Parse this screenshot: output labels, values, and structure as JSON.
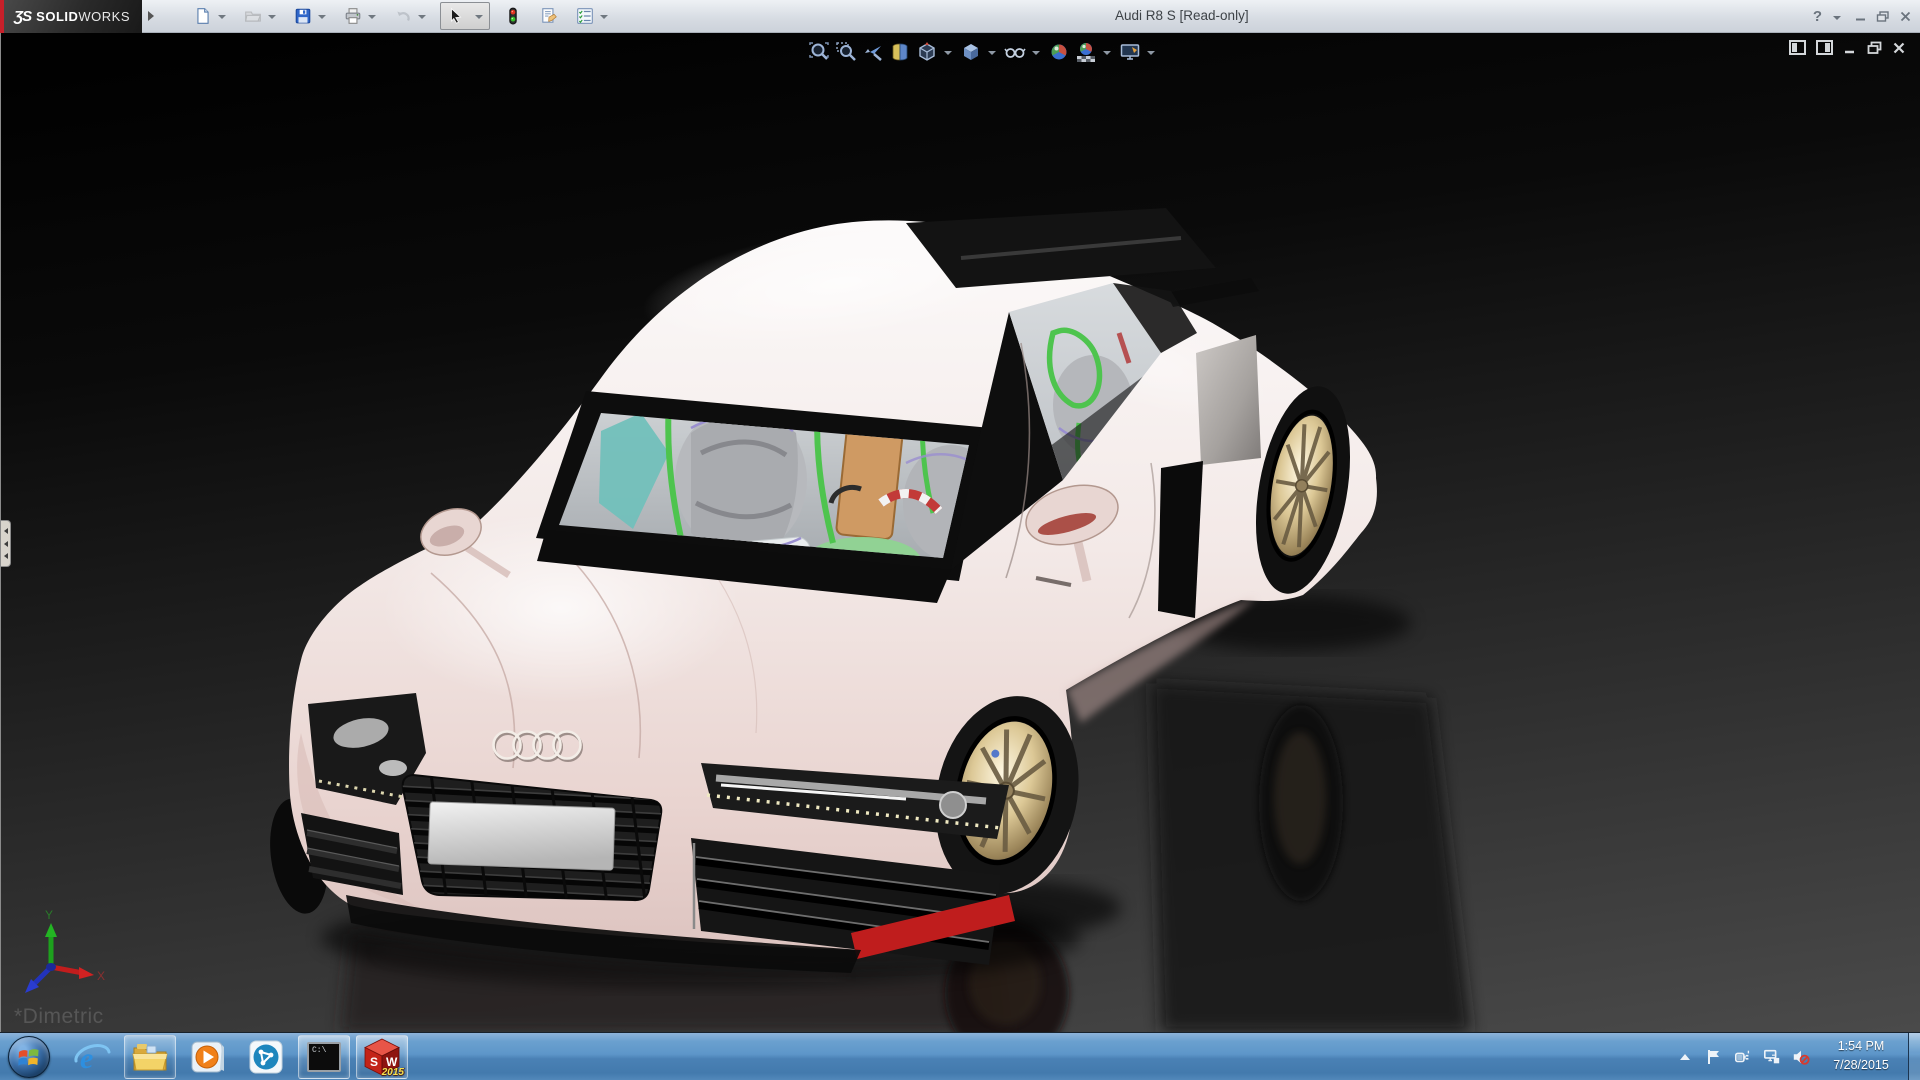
{
  "window": {
    "title": "Audi R8 S [Read-only]",
    "brand": {
      "glyph": "ƷS",
      "bold": "SOLID",
      "light": "WORKS"
    },
    "main_toolbar": [
      {
        "icon": "new-document-icon",
        "dropdown": true,
        "enabled": true
      },
      {
        "icon": "open-icon",
        "dropdown": true,
        "enabled": false
      },
      {
        "icon": "save-icon",
        "dropdown": true,
        "enabled": true
      },
      {
        "icon": "print-icon",
        "dropdown": true,
        "enabled": true
      },
      {
        "icon": "undo-icon",
        "dropdown": true,
        "enabled": false
      },
      {
        "icon": "select-arrow-icon",
        "dropdown": true,
        "enabled": true,
        "selected": true
      },
      {
        "icon": "rebuild-traffic-light-icon",
        "dropdown": false,
        "enabled": true
      },
      {
        "icon": "file-properties-icon",
        "dropdown": false,
        "enabled": true
      },
      {
        "icon": "options-icon",
        "dropdown": true,
        "enabled": true
      }
    ],
    "titlebar_controls": {
      "help_glyph": "?",
      "icons": [
        "help-icon",
        "minimize-icon",
        "restore-icon",
        "close-icon"
      ]
    }
  },
  "viewport": {
    "heads_up_toolbar": [
      {
        "icon": "zoom-to-fit-icon"
      },
      {
        "icon": "zoom-to-area-icon"
      },
      {
        "icon": "previous-view-icon"
      },
      {
        "icon": "section-view-icon"
      },
      {
        "icon": "view-orientation-icon",
        "dropdown": true
      },
      {
        "icon": "display-style-icon",
        "dropdown": true
      },
      {
        "icon": "hide-show-items-icon",
        "dropdown": true
      },
      {
        "icon": "edit-appearance-icon"
      },
      {
        "icon": "apply-scene-icon",
        "dropdown": true
      },
      {
        "icon": "view-settings-icon",
        "dropdown": true
      }
    ],
    "document_controls": [
      "pane-left-icon",
      "pane-right-icon",
      "minimize-icon",
      "restore-icon",
      "close-icon"
    ],
    "orientation_label": "*Dimetric",
    "triad": {
      "x_label": "X",
      "y_label": "Y"
    },
    "model": {
      "subject": "Audi R8 coupe 3D model, front three-quarter view",
      "body_color": "#efe0dc",
      "interior_rollcage_green": "#4ec44e",
      "interior_seat_gray": "#b4b6ba",
      "interior_panel_tan": "#cf9a63",
      "interior_dash_teal": "#72c0ba",
      "accent_red": "#bf1d1d",
      "background_top": "#010101",
      "background_bottom": "#4a4a4a"
    }
  },
  "taskbar": {
    "color": "#5d96c9",
    "start": {
      "icon": "windows-start-orb-icon"
    },
    "apps": [
      {
        "icon": "internet-explorer-icon",
        "open": false
      },
      {
        "icon": "windows-explorer-icon",
        "open": true
      },
      {
        "icon": "media-player-icon",
        "open": false
      },
      {
        "icon": "share-app-icon",
        "open": false
      },
      {
        "icon": "command-prompt-icon",
        "open": true
      },
      {
        "icon": "solidworks-2015-icon",
        "open": true
      }
    ],
    "ie_glyph": "e",
    "cmd_label": "C:\\",
    "sw": {
      "s": "S",
      "w": "W",
      "year": "2015"
    },
    "tray": {
      "icons": [
        "show-hidden-icons-icon",
        "action-center-flag-icon",
        "power-plug-icon",
        "network-icon",
        "volume-muted-icon"
      ],
      "time": "1:54 PM",
      "date": "7/28/2015"
    }
  }
}
